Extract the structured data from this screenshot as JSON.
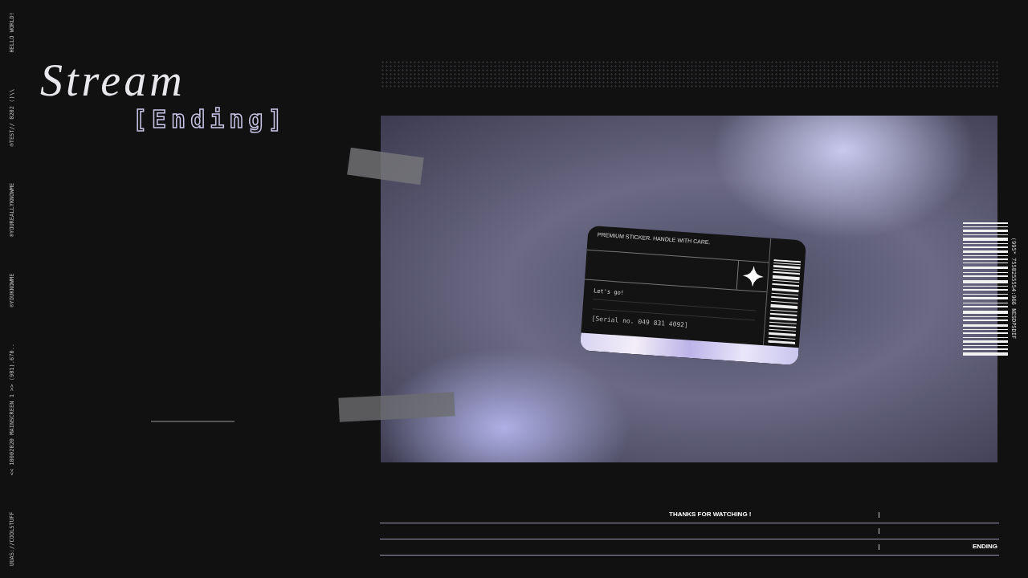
{
  "side_labels": [
    "UUAS://COOLSTUFF",
    "<< 10002020 MAINSCREEN 1 >> (981).670..",
    "®YOUKNOWME",
    "®YOUREALLYKNOWME",
    "®TEST// 0202 ()\\\\",
    "HELLO WORLD!"
  ],
  "title": {
    "script": "Stream",
    "bracket": "[Ending]"
  },
  "card": {
    "heading": "PREMIUM STICKER. HANDLE WITH CARE.",
    "note": "Let's go!",
    "serial": "[Serial no. 049 831 4092]"
  },
  "barcode_code": "(995* 7558255554:966 NESDPSDIF",
  "footer": {
    "message": "THANKS FOR WATCHING !",
    "end_label": "ENDING"
  }
}
